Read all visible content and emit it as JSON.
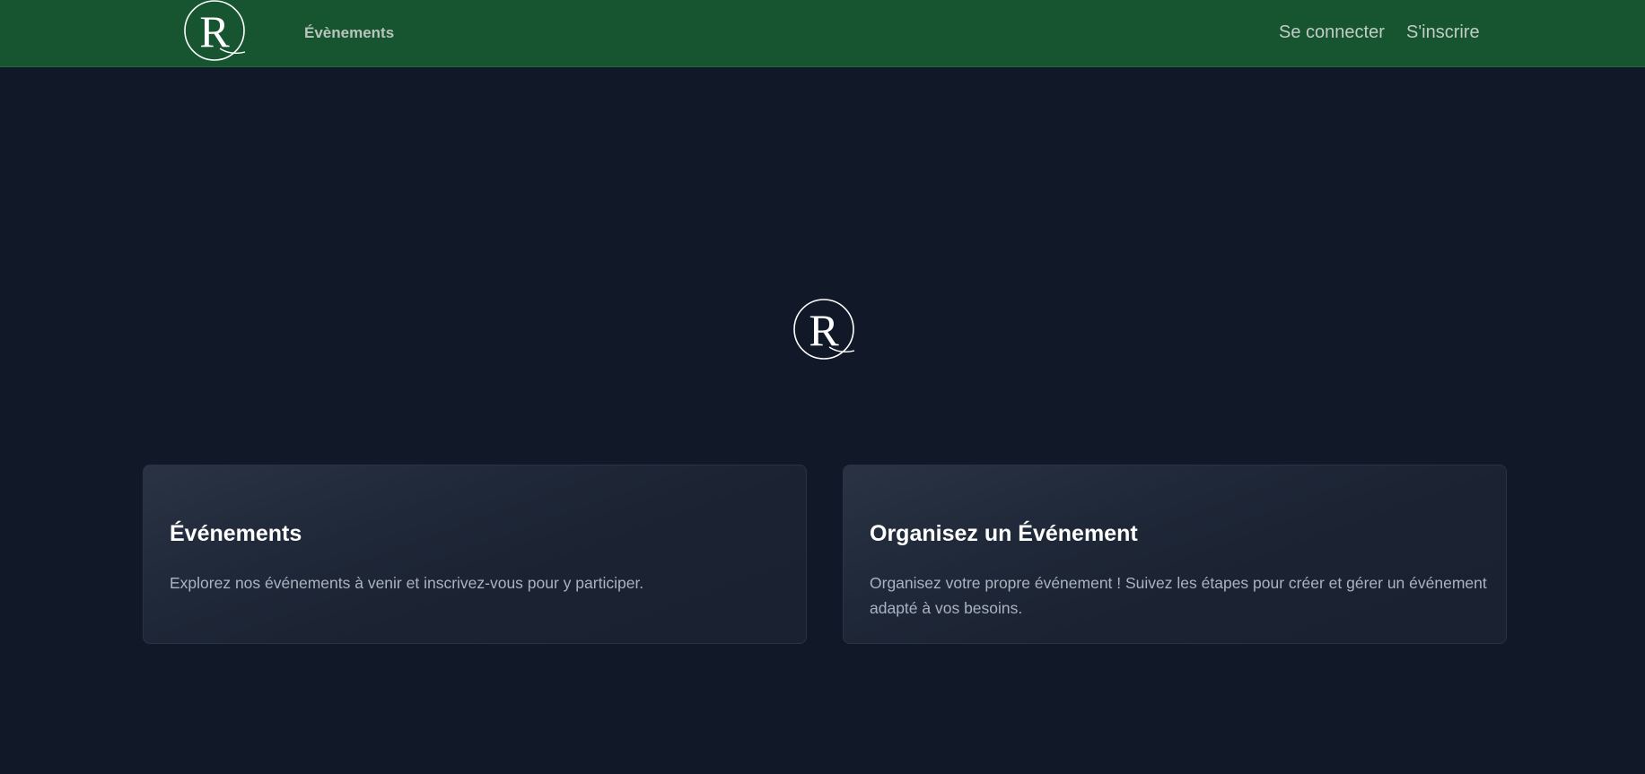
{
  "app": {
    "logo_letter": "R"
  },
  "navbar": {
    "events_link": "Évènements",
    "login_link": "Se connecter",
    "signup_link": "S'inscrire"
  },
  "hero": {
    "logo_letter": "R"
  },
  "cards": [
    {
      "title": "Événements",
      "description": "Explorez nos événements à venir et inscrivez-vous pour y participer."
    },
    {
      "title": "Organisez un Événement",
      "description": "Organisez votre propre événement ! Suivez les étapes pour créer et gérer un événement adapté à vos besoins."
    }
  ],
  "icons": {
    "brand_logo": "monogram-r-logo-icon"
  },
  "colors": {
    "navbar_bg": "#16552f",
    "page_bg": "#111827",
    "card_bg": "#1f2838",
    "card_border": "#2a3344",
    "title_text": "#ffffff",
    "body_text": "#aab3c0",
    "nav_text": "#c2ccc6"
  }
}
